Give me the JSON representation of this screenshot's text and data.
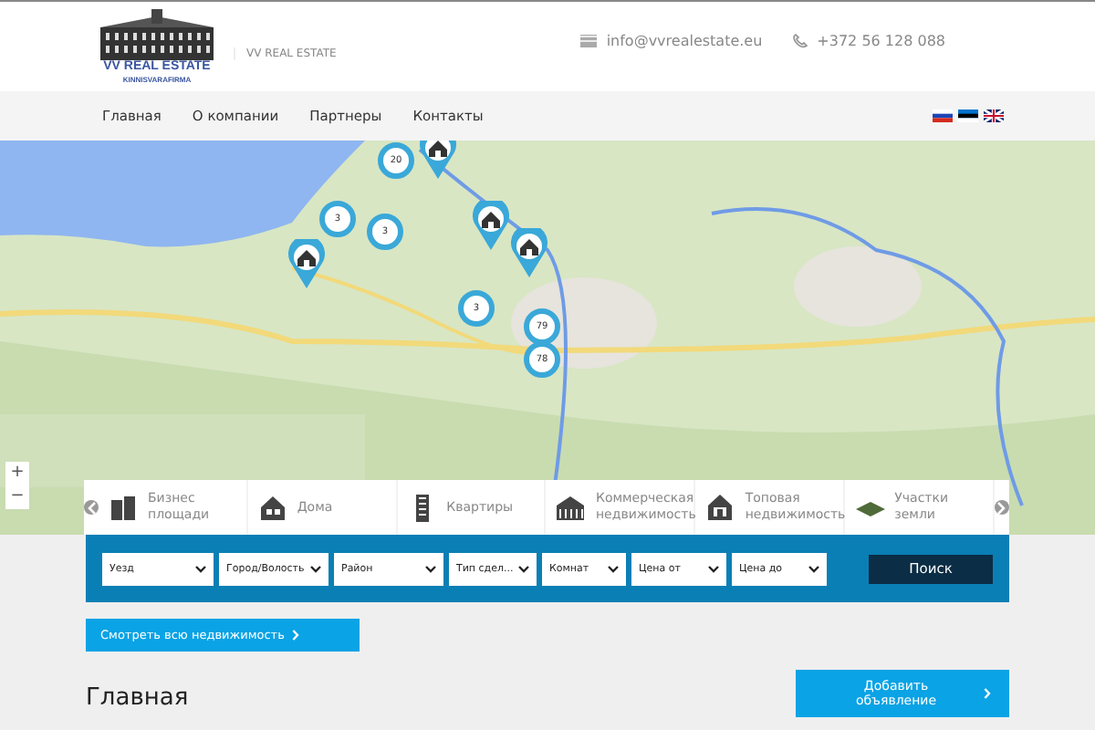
{
  "header": {
    "logo": {
      "title": "VV REAL ESTATE",
      "subtitle": "KINNISVARAFIRMA"
    },
    "tagline": "VV REAL ESTATE",
    "email": "info@vvrealestate.eu",
    "phone": "+372 56 128 088"
  },
  "nav": [
    {
      "label": "Главная"
    },
    {
      "label": "О компании"
    },
    {
      "label": "Партнеры"
    },
    {
      "label": "Контакты"
    }
  ],
  "languages": [
    {
      "kind": "ru"
    },
    {
      "kind": "ee"
    },
    {
      "kind": "gb"
    }
  ],
  "map": {
    "kind": "picture",
    "zoom_controls": [
      "+",
      "−"
    ],
    "markers": [
      {
        "kind": "pin"
      },
      {
        "kind": "cluster",
        "count": "20"
      },
      {
        "kind": "cluster",
        "count": "3"
      },
      {
        "kind": "cluster",
        "count": "3"
      },
      {
        "kind": "pin"
      },
      {
        "kind": "pin"
      },
      {
        "kind": "pin"
      },
      {
        "kind": "cluster",
        "count": "3"
      },
      {
        "kind": "cluster",
        "count": "79"
      },
      {
        "kind": "cluster",
        "count": "78"
      }
    ]
  },
  "categories": [
    {
      "kind": "office",
      "label": "Бизнес площади"
    },
    {
      "kind": "house",
      "label": "Дома"
    },
    {
      "kind": "flat",
      "label": "Квартиры"
    },
    {
      "kind": "commercial",
      "label": "Коммерческая недвижимость"
    },
    {
      "kind": "top",
      "label": "Топовая недвижимость"
    },
    {
      "kind": "land",
      "label": "Участки земли"
    }
  ],
  "search": {
    "fields": [
      {
        "value": "Уезд"
      },
      {
        "value": "Город/Волость"
      },
      {
        "value": "Район"
      },
      {
        "value": "Тип сдел..."
      },
      {
        "value": "Комнат"
      },
      {
        "value": "Цена от"
      },
      {
        "value": "Цена до"
      }
    ],
    "button": "Поиск"
  },
  "all_button": "Смотреть всю недвижимость",
  "heading": "Главная",
  "add_button": "Добавить объявление"
}
